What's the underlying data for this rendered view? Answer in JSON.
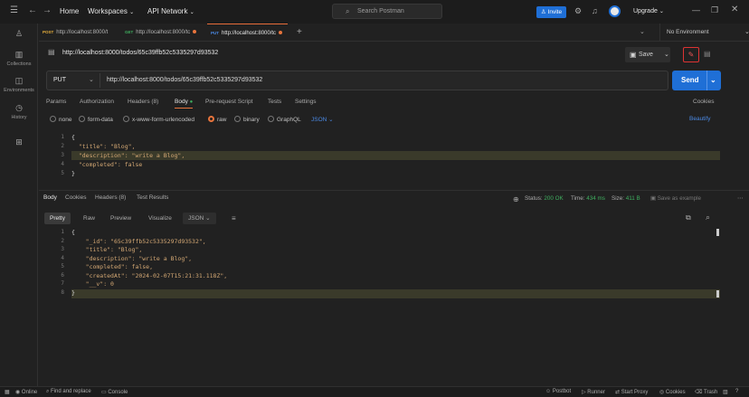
{
  "titlebar": {
    "home": "Home",
    "workspaces": "Workspaces",
    "api_network": "API Network",
    "search_placeholder": "Search Postman",
    "invite": "Invite",
    "upgrade": "Upgrade"
  },
  "sidebar": {
    "items": [
      {
        "label": "Collections"
      },
      {
        "label": "Environments"
      },
      {
        "label": "History"
      }
    ]
  },
  "tabs": [
    {
      "method": "POST",
      "label": "http://localhost:8000/t"
    },
    {
      "method": "GET",
      "label": "http://localhost:8000/tc"
    },
    {
      "method": "PUT",
      "label": "http://localhost:8000/tc"
    }
  ],
  "environment": "No Environment",
  "request": {
    "title": "http://localhost:8000/todos/65c39ffb52c5335297d93532",
    "save": "Save",
    "method": "PUT",
    "url": "http://localhost:8000/todos/65c39ffb52c5335297d93532",
    "send": "Send",
    "tabs": [
      "Params",
      "Authorization",
      "Headers (8)",
      "Body",
      "Pre-request Script",
      "Tests",
      "Settings"
    ],
    "cookies": "Cookies",
    "body_types": [
      "none",
      "form-data",
      "x-www-form-urlencoded",
      "raw",
      "binary",
      "GraphQL"
    ],
    "body_format": "JSON",
    "beautify": "Beautify",
    "body_lines": [
      "{",
      "  \"title\": \"Blog\",",
      "  \"description\": \"write a Blog\",",
      "  \"completed\": false",
      "}"
    ]
  },
  "response": {
    "tabs": [
      "Body",
      "Cookies",
      "Headers (8)",
      "Test Results"
    ],
    "status_label": "Status:",
    "status": "200 OK",
    "time_label": "Time:",
    "time": "434 ms",
    "size_label": "Size:",
    "size": "411 B",
    "save_example": "Save as example",
    "views": [
      "Pretty",
      "Raw",
      "Preview",
      "Visualize"
    ],
    "format": "JSON",
    "body_lines": [
      "{",
      "    \"_id\": \"65c39ffb52c5335297d93532\",",
      "    \"title\": \"Blog\",",
      "    \"description\": \"write a Blog\",",
      "    \"completed\": false,",
      "    \"createdAt\": \"2024-02-07T15:21:31.118Z\",",
      "    \"__v\": 0",
      "}"
    ]
  },
  "statusbar": {
    "online": "Online",
    "find_replace": "Find and replace",
    "console": "Console",
    "postbot": "Postbot",
    "runner": "Runner",
    "start_proxy": "Start Proxy",
    "cookies": "Cookies",
    "trash": "Trash"
  },
  "colors": {
    "accent_blue": "#1f6fd6",
    "accent_orange": "#e8743c",
    "status_green": "#3fae5f"
  }
}
